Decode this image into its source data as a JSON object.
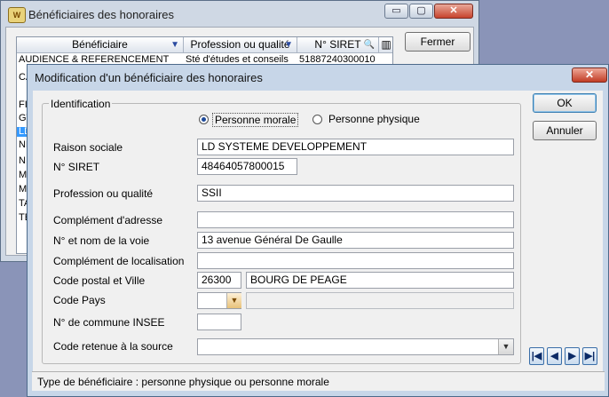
{
  "back_window": {
    "title": "Bénéficiaires des honoraires",
    "min_glyph": "▭",
    "max_glyph": "▢",
    "close_glyph": "✕",
    "app_icon_text": "W",
    "close_button": "Fermer",
    "columns": [
      "Bénéficiaire",
      "Profession ou qualité",
      "N° SIRET"
    ],
    "first_row": [
      "AUDIENCE & REFERENCEMENT",
      "Sté d'études et conseils",
      "51887240300010"
    ],
    "row_prefixes": [
      "CA",
      "FI",
      "GT",
      "LD",
      "NE",
      "NI",
      "MI",
      "MI",
      "TA",
      "TE"
    ]
  },
  "dialog": {
    "title": "Modification d'un bénéficiaire des honoraires",
    "close_glyph": "✕",
    "group_label": "Identification",
    "radio_morale": "Personne morale",
    "radio_physique": "Personne physique",
    "selected_type": "morale",
    "labels": {
      "raison_sociale": "Raison sociale",
      "siret": "N° SIRET",
      "profession": "Profession ou qualité",
      "complement_adresse": "Complément d'adresse",
      "voie": "N° et nom de la voie",
      "complement_localisation": "Complément de localisation",
      "code_postal_ville": "Code postal et Ville",
      "code_pays": "Code Pays",
      "insee": "N° de commune INSEE",
      "code_retenue": "Code retenue à la source"
    },
    "values": {
      "raison_sociale": "LD SYSTEME DEVELOPPEMENT",
      "siret": "48464057800015",
      "profession": "SSII",
      "complement_adresse": "",
      "voie": "13 avenue Général De Gaulle",
      "complement_localisation": "",
      "code_postal": "26300",
      "ville": "BOURG DE PEAGE",
      "code_pays": "",
      "pays_label": "",
      "insee": "",
      "code_retenue": ""
    },
    "ok_button": "OK",
    "cancel_button": "Annuler",
    "nav": {
      "first": "|◀",
      "prev": "◀",
      "next": "▶",
      "last": "▶|"
    },
    "status_text": "Type de bénéficiaire : personne physique ou personne morale"
  }
}
